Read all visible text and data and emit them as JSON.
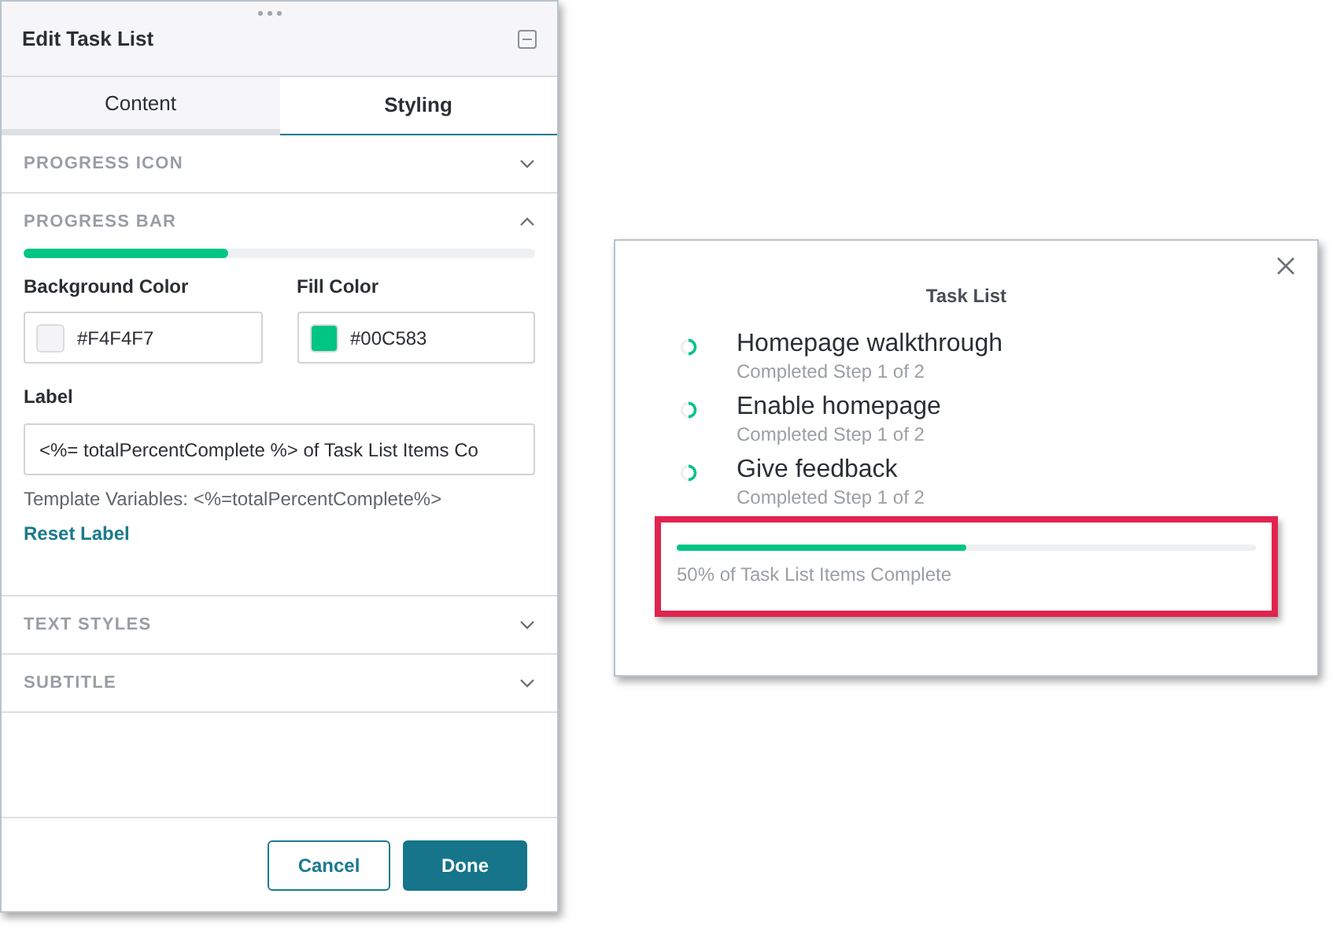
{
  "editor": {
    "title": "Edit Task List",
    "tabs": [
      {
        "label": "Content",
        "selected": false
      },
      {
        "label": "Styling",
        "selected": true
      }
    ],
    "sections": [
      {
        "title": "PROGRESS ICON",
        "expanded": false
      },
      {
        "title": "PROGRESS BAR",
        "expanded": true
      },
      {
        "title": "TEXT STYLES",
        "expanded": false
      },
      {
        "title": "SUBTITLE",
        "expanded": false
      }
    ],
    "progress_bar": {
      "level": 0.4,
      "background_color": {
        "label": "Background Color",
        "value": "#F4F4F7",
        "color": "#f4f4f7"
      },
      "fill_color": {
        "label": "Fill Color",
        "value": "#00C583",
        "color": "#00c583"
      },
      "label": {
        "label": "Label",
        "value": "<%= totalPercentComplete %> of Task List Items Co"
      },
      "template_hint": "Template Variables: <%=totalPercentComplete%>",
      "reset_link": "Reset Label"
    },
    "buttons": {
      "cancel": "Cancel",
      "done": "Done"
    }
  },
  "preview": {
    "title": "Task List",
    "tasks": [
      {
        "name": "Homepage walkthrough",
        "status": "Completed Step 1 of 2"
      },
      {
        "name": "Enable homepage",
        "status": "Completed Step 1 of 2"
      },
      {
        "name": "Give feedback",
        "status": "Completed Step 1 of 2"
      }
    ],
    "progress": {
      "level": 0.5,
      "label": "50% of Task List Items Complete"
    }
  }
}
